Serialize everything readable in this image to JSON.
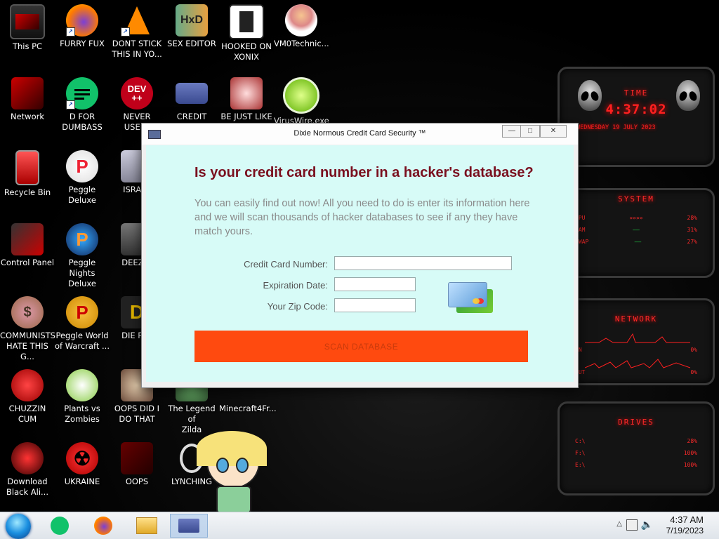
{
  "desktop_icons": [
    {
      "label": "This PC"
    },
    {
      "label": "FURRY FUX"
    },
    {
      "label": "DONT STICK\nTHIS IN YO..."
    },
    {
      "label": "SEX EDITOR"
    },
    {
      "label": "HOOKED ON\nXONIX"
    },
    {
      "label": "VM0Technic..."
    },
    {
      "label": "Network"
    },
    {
      "label": "D FOR\nDUMBASS"
    },
    {
      "label": "NEVER USED!"
    },
    {
      "label": "CREDIT CARD"
    },
    {
      "label": "BE JUST LIKE"
    },
    {
      "label": "VirusWire.exe"
    },
    {
      "label": "Recycle Bin"
    },
    {
      "label": "Peggle Deluxe"
    },
    {
      "label": "ISRAEL"
    },
    {
      "label": "Control Panel"
    },
    {
      "label": "Peggle Nights\nDeluxe"
    },
    {
      "label": "DEEZ N"
    },
    {
      "label": "COMMUNISTS\nHATE THIS G..."
    },
    {
      "label": "Peggle World\nof Warcraft ..."
    },
    {
      "label": "DIE PLE"
    },
    {
      "label": "CHUZZIN\nCUM"
    },
    {
      "label": "Plants vs\nZombies"
    },
    {
      "label": "OOPS DID I\nDO THAT"
    },
    {
      "label": "The Legend of\nZilda"
    },
    {
      "label": "Minecraft4Fr..."
    },
    {
      "label": "Download\nBlack Ali..."
    },
    {
      "label": "UKRAINE"
    },
    {
      "label": "OOPS"
    },
    {
      "label": "LYNCHING"
    }
  ],
  "icon_glyphs": {
    "dev": "DEV\n++",
    "hxd": "HxD",
    "peggle": "P",
    "deez": "D"
  },
  "gadgets": {
    "time_title": "TIME",
    "time_value": "4:37:02",
    "date_value": "WEDNESDAY 19 JULY 2023",
    "system_title": "SYSTEM",
    "system_stats": [
      {
        "label": "CPU",
        "value": "28%"
      },
      {
        "label": "RAM",
        "value": "31%"
      },
      {
        "label": "SWAP",
        "value": "27%"
      }
    ],
    "network_title": "NETWORK",
    "network_stats": [
      {
        "label": "IN",
        "value": "0%"
      },
      {
        "label": "OUT",
        "value": "0%"
      }
    ],
    "drives_title": "DRIVES",
    "drive_stats": [
      {
        "label": "C:\\",
        "value": "28%"
      },
      {
        "label": "F:\\",
        "value": "100%"
      },
      {
        "label": "E:\\",
        "value": "100%"
      }
    ]
  },
  "dialog": {
    "title": "Dixie Normous Credit Card Security ™",
    "min_glyph": "—",
    "max_glyph": "□",
    "close_glyph": "✕",
    "headline": "Is your credit card number in a hacker's database?",
    "blurb": "You can easily find out now! All you need to do is enter its information here and we will scan thousands of hacker databases to see if any they have match yours.",
    "fields": {
      "card_number_label": "Credit Card Number:",
      "expiration_label": "Expiration Date:",
      "zip_label": "Your Zip Code:",
      "card_number_value": "",
      "expiration_value": "",
      "zip_value": ""
    },
    "scan_button_label": "SCAN DATABASE"
  },
  "taskbar": {
    "time": "4:37 AM",
    "date": "7/19/2023",
    "tray_chevron": "△"
  },
  "colors": {
    "dialog_bg": "#d7fbf7",
    "headline": "#7a0f1e",
    "scan_button": "#ff4a0f",
    "gadget_red": "#ff2020"
  }
}
